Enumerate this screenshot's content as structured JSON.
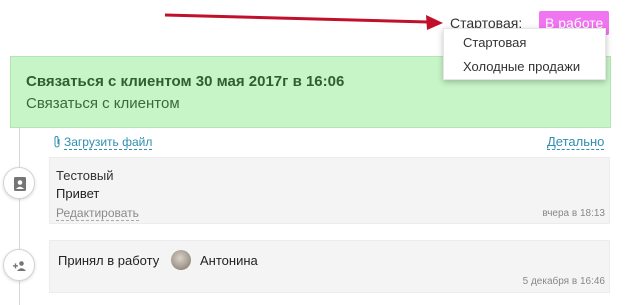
{
  "colors": {
    "arrow": "#c0102a",
    "stage_badge_bg": "#f075f0",
    "task_card_bg": "#c8f5c8",
    "link": "#2f8fb0"
  },
  "stage": {
    "label": "Стартовая:",
    "current": "В работе",
    "options": [
      "Стартовая",
      "Холодные продажи"
    ]
  },
  "task": {
    "title": "Связаться с клиентом 30 мая 2017г в 16:06",
    "subtitle": "Связаться с клиентом"
  },
  "links": {
    "upload": "Загрузить файл",
    "details": "Детально"
  },
  "timeline": {
    "comment": {
      "author": "Тестовый",
      "text": "Привет",
      "edit": "Редактировать",
      "time": "вчера в 18:13",
      "icon": "contact-card-icon"
    },
    "event": {
      "text": "Принял в работу",
      "user": "Антонина",
      "time": "5 декабря в 16:46",
      "icon": "add-user-icon"
    }
  }
}
